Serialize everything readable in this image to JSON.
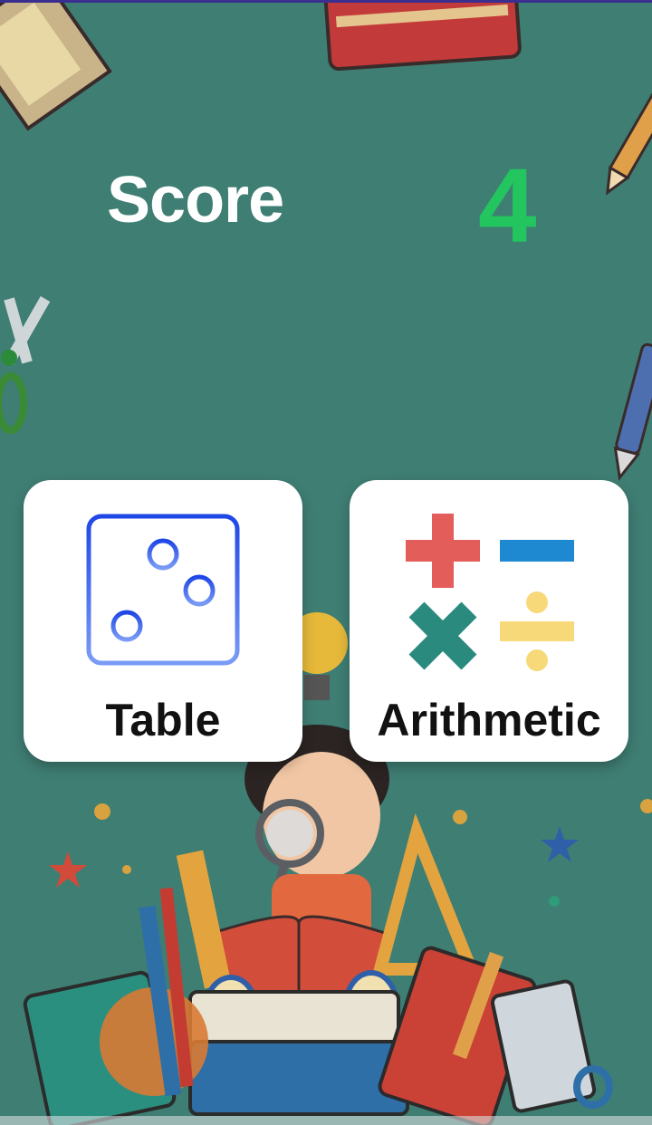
{
  "score": {
    "label": "Score",
    "value": "4"
  },
  "menu": {
    "table": {
      "label": "Table",
      "icon": "grid-table-icon"
    },
    "arithmetic": {
      "label": "Arithmetic",
      "icon": "arithmetic-operators-icon"
    }
  },
  "colors": {
    "background": "#3f7e73",
    "score_value": "#22c55e",
    "card": "#ffffff",
    "table_icon": "#2f5bea",
    "plus": "#e35d5b",
    "minus": "#1e88d0",
    "times": "#2a8a7e",
    "divide": "#f7d97a"
  }
}
